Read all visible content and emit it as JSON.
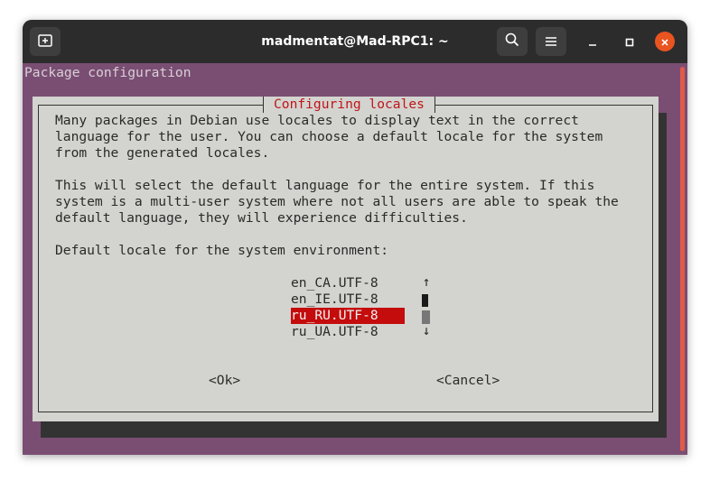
{
  "window": {
    "title": "madmentat@Mad-RPC1: ~"
  },
  "terminal": {
    "header": "Package configuration"
  },
  "dialog": {
    "title": "Configuring locales",
    "paragraph1": [
      "Many packages in Debian use locales to display text in the correct",
      "language for the user. You can choose a default locale for the system",
      "from the generated locales."
    ],
    "paragraph2": [
      "This will select the default language for the entire system. If this",
      "system is a multi-user system where not all users are able to speak the",
      "default language, they will experience difficulties."
    ],
    "prompt": "Default locale for the system environment:",
    "locales": [
      "en_CA.UTF-8",
      "en_IE.UTF-8",
      "ru_RU.UTF-8",
      "ru_UA.UTF-8"
    ],
    "selected_locale": "ru_RU.UTF-8",
    "ok_label": "<Ok>",
    "cancel_label": "<Cancel>"
  },
  "icons": {
    "new_tab": "new-tab-icon",
    "search": "search-icon",
    "menu": "hamburger-menu-icon",
    "minimize": "minimize-icon",
    "maximize": "maximize-icon",
    "close": "close-icon",
    "scroll_up": "arrow-up-icon",
    "scroll_down": "arrow-down-icon"
  },
  "colors": {
    "terminal_bg": "#7a4e73",
    "dialog_bg": "#d3d3cf",
    "dialog_title": "#c0151a",
    "selection_bg": "#c40c0c",
    "titlebar_bg": "#2c2c2c",
    "close_button": "#e95420"
  }
}
